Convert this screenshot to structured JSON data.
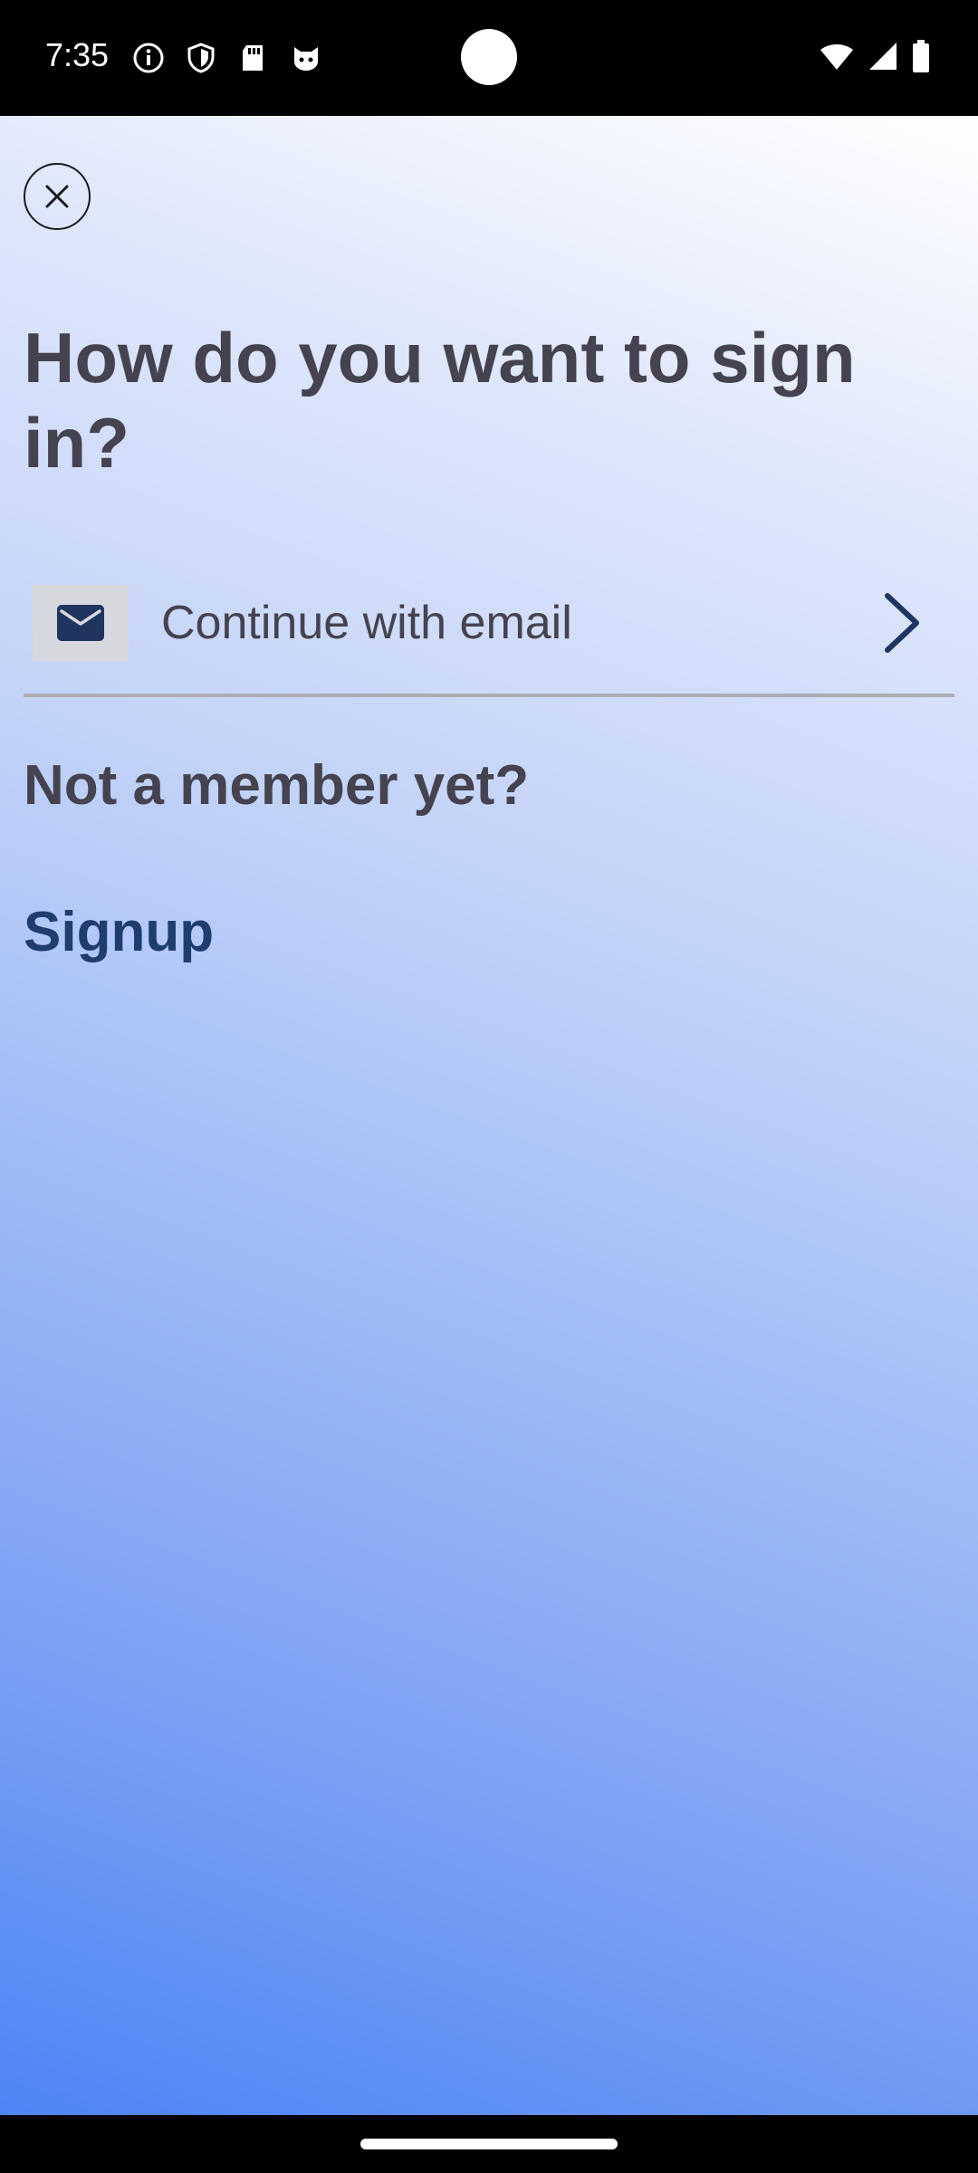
{
  "status_bar": {
    "time": "7:35",
    "left_icons": [
      "info-icon",
      "shield-icon",
      "sd-card-icon",
      "cat-icon"
    ],
    "right_icons": [
      "wifi-icon",
      "signal-icon",
      "battery-icon"
    ]
  },
  "signin": {
    "title": "How do you want to sign in?",
    "email_option_label": "Continue with email",
    "not_member_text": "Not a member yet?",
    "signup_label": "Signup"
  },
  "colors": {
    "title_text": "#45434f",
    "signup_link": "#1f3d6e",
    "email_icon": "#1f3560",
    "gradient_top": "#ffffff",
    "gradient_bottom": "#4d84f4"
  }
}
